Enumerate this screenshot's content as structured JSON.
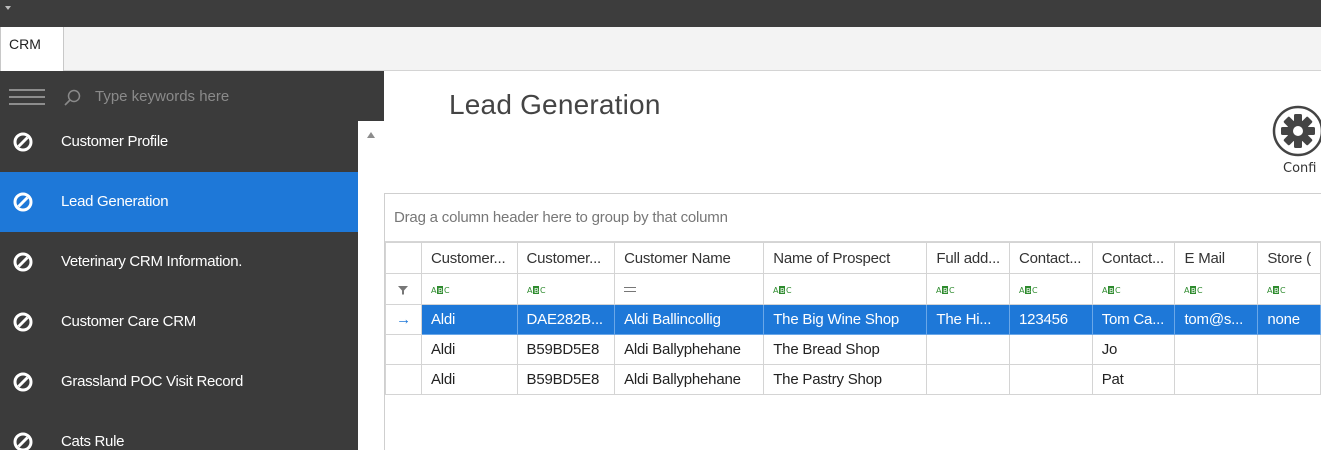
{
  "tabs": [
    {
      "label": "CRM"
    }
  ],
  "search": {
    "placeholder": "Type keywords here"
  },
  "nav": {
    "items": [
      {
        "label": "Customer Profile",
        "active": false
      },
      {
        "label": "Lead Generation",
        "active": true
      },
      {
        "label": "Veterinary CRM Information.",
        "active": false
      },
      {
        "label": "Customer Care CRM",
        "active": false
      },
      {
        "label": "Grassland POC Visit Record",
        "active": false
      },
      {
        "label": "Cats Rule",
        "active": false
      }
    ],
    "icon": "prohibited-circle-icon"
  },
  "page": {
    "title": "Lead Generation"
  },
  "toolbar": {
    "config_label": "Confi",
    "config_icon": "gear-icon"
  },
  "grid": {
    "group_panel_text": "Drag a column header here to group by that column",
    "columns": [
      "Customer...",
      "Customer...",
      "Customer Name",
      "Name of Prospect",
      "Full add...",
      "Contact...",
      "Contact...",
      "E Mail",
      "Store ("
    ],
    "filter_types": [
      "abc",
      "abc",
      "equals",
      "abc",
      "abc",
      "abc",
      "abc",
      "abc",
      "abc"
    ],
    "rows": [
      {
        "selected": true,
        "cells": [
          "Aldi",
          "DAE282B...",
          "Aldi Ballincollig",
          "The Big Wine Shop",
          "The Hi...",
          "123456",
          "Tom Ca...",
          "tom@s...",
          "none"
        ]
      },
      {
        "selected": false,
        "cells": [
          "Aldi",
          "B59BD5E8",
          "Aldi Ballyphehane",
          "The Bread Shop",
          "",
          "",
          "Jo",
          "",
          ""
        ]
      },
      {
        "selected": false,
        "cells": [
          "Aldi",
          "B59BD5E8",
          "Aldi Ballyphehane",
          "The Pastry Shop",
          "",
          "",
          "Pat",
          "",
          ""
        ]
      }
    ]
  },
  "colors": {
    "accent": "#1e78d8",
    "sidebar_bg": "#3b3b3b",
    "titlebar_bg": "#3d3d3d"
  }
}
